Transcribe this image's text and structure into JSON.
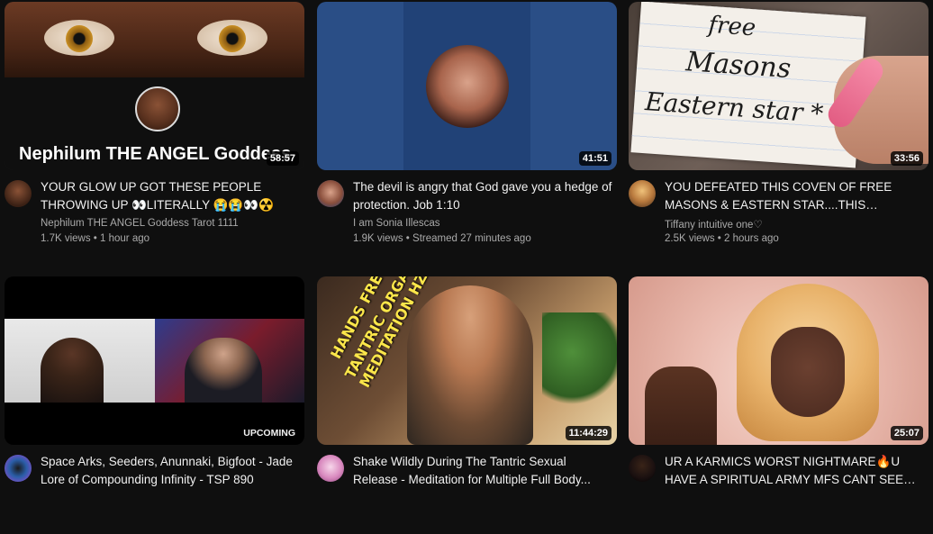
{
  "videos": [
    {
      "title": "YOUR GLOW UP GOT THESE PEOPLE THROWING UP 👀LITERALLY 😭😭👀☢️",
      "channel": "Nephilum THE ANGEL Goddess Tarot 1111",
      "stats": "1.7K views • 1 hour ago",
      "duration": "58:57",
      "thumb_text": "Nephilum THE ANGEL Goddess"
    },
    {
      "title": "The devil is angry that God gave you a hedge of protection. Job 1:10",
      "channel": "I am Sonia Illescas",
      "stats": "1.9K views • Streamed 27 minutes ago",
      "duration": "41:51"
    },
    {
      "title": "YOU DEFEATED THIS COVEN OF FREE MASONS & EASTERN STAR....THIS OCCULT...",
      "channel": "Tiffany intuitive one♡",
      "stats": "2.5K views • 2 hours ago",
      "duration": "33:56",
      "thumb_text": [
        "free",
        "Masons",
        "Eastern star *"
      ]
    },
    {
      "title": "Space Arks, Seeders, Anunnaki, Bigfoot - Jade Lore of Compounding Infinity - TSP 890",
      "badge": "UPCOMING"
    },
    {
      "title": "Shake Wildly During The Tantric Sexual Release - Meditation for Multiple Full Body...",
      "duration": "11:44:29",
      "thumb_text": [
        "HANDS FREE",
        "TANTRIC ORGASM",
        "MEDITATION HZ"
      ]
    },
    {
      "title": "UR A KARMICS WORST NIGHTMARE🔥U HAVE A SPIRITUAL ARMY MFS CANT SEE U...",
      "duration": "25:07"
    }
  ]
}
